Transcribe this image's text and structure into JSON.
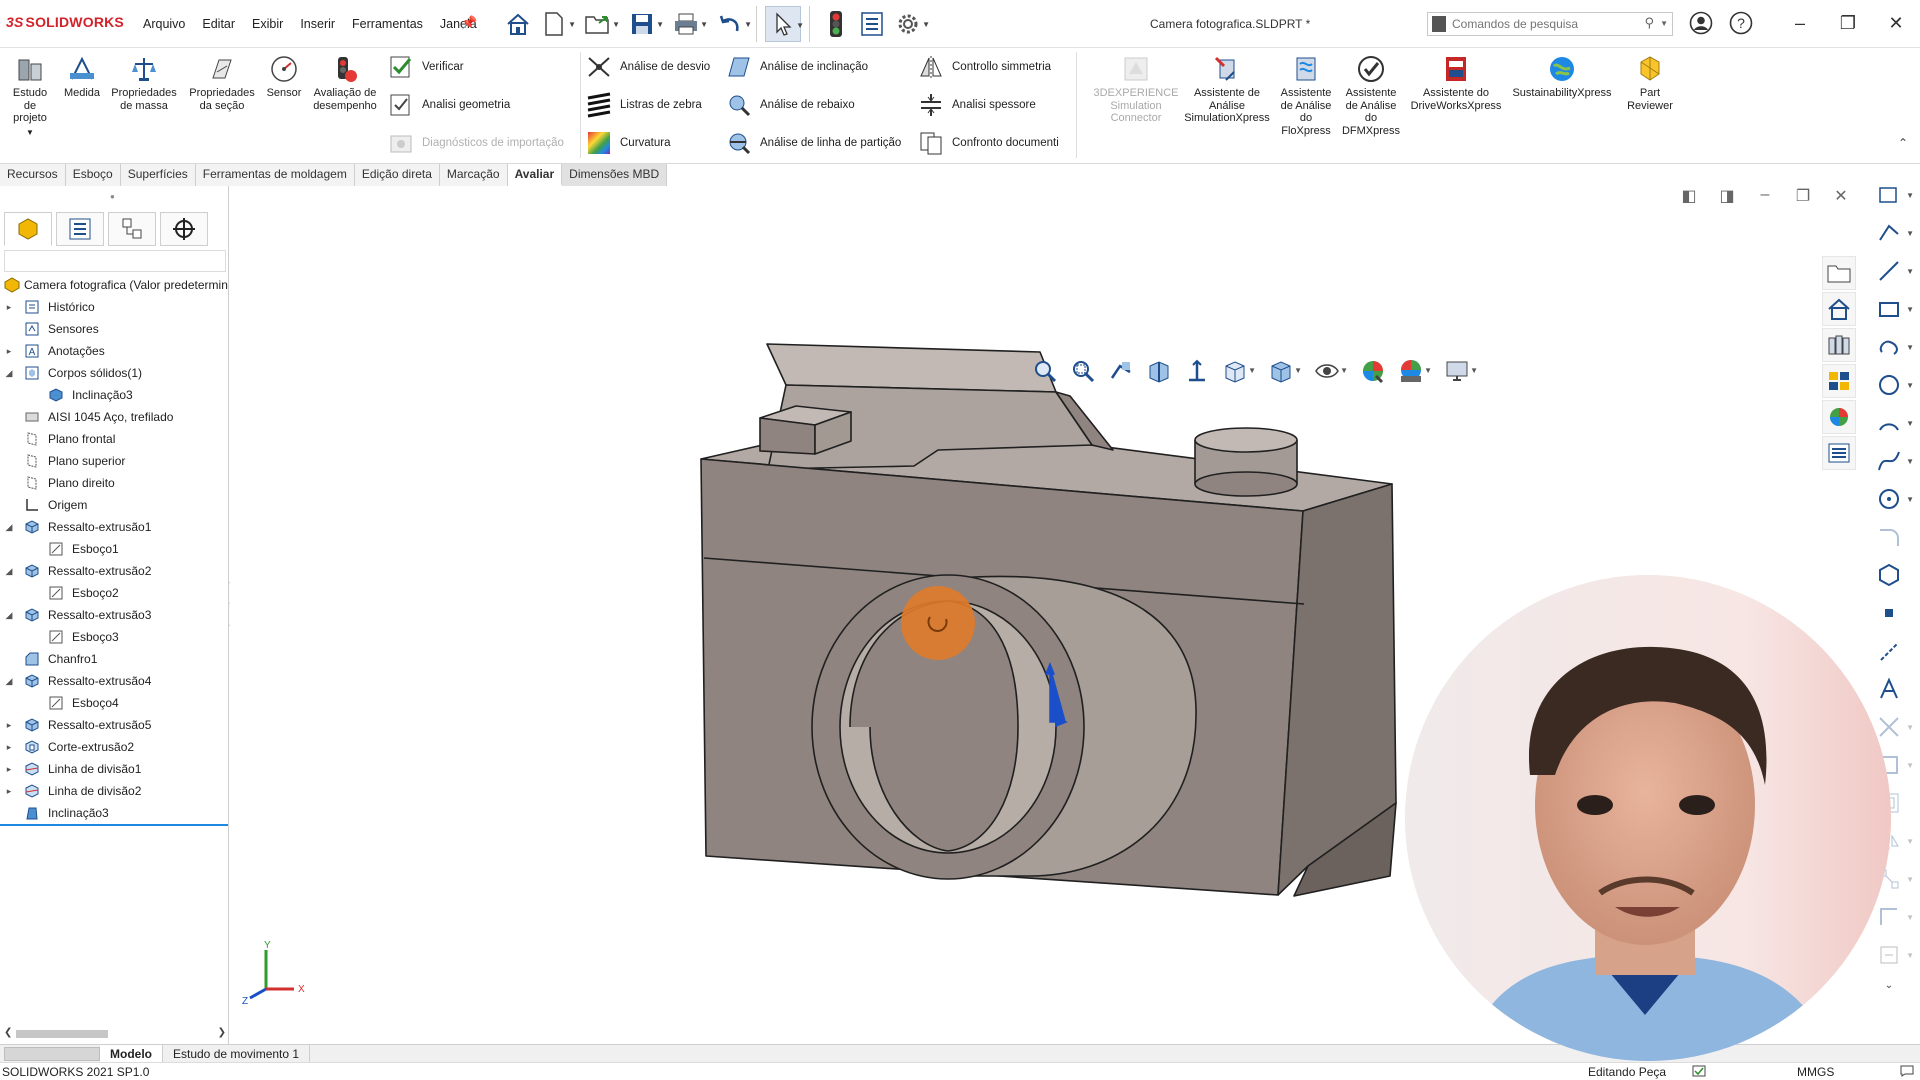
{
  "app": {
    "logo": "SOLIDWORKS",
    "document_title": "Camera fotografica.SLDPRT *",
    "menu": [
      "Arquivo",
      "Editar",
      "Exibir",
      "Inserir",
      "Ferramentas",
      "Janela"
    ],
    "search_placeholder": "Comandos de pesquisa"
  },
  "ribbon": {
    "large_buttons": [
      {
        "label": "Estudo de projeto",
        "icon": "design-study-icon"
      },
      {
        "label": "Medida",
        "icon": "measure-icon"
      },
      {
        "label": "Propriedades de massa",
        "icon": "mass-properties-icon"
      },
      {
        "label": "Propriedades da seção",
        "icon": "section-properties-icon"
      },
      {
        "label": "Sensor",
        "icon": "sensor-icon"
      },
      {
        "label": "Avaliação de desempenho",
        "icon": "performance-evaluation-icon"
      }
    ],
    "check_group": [
      {
        "label": "Verificar",
        "icon": "check-icon"
      },
      {
        "label": "Analisi geometria",
        "icon": "geometry-analysis-icon"
      },
      {
        "label": "Diagnósticos de importação",
        "icon": "import-diagnostics-icon",
        "disabled": true
      }
    ],
    "analysis_col1": [
      {
        "label": "Análise de desvio",
        "icon": "deviation-analysis-icon"
      },
      {
        "label": "Listras de zebra",
        "icon": "zebra-stripes-icon"
      },
      {
        "label": "Curvatura",
        "icon": "curvature-icon"
      }
    ],
    "analysis_col2": [
      {
        "label": "Análise de inclinação",
        "icon": "draft-analysis-icon"
      },
      {
        "label": "Análise de rebaixo",
        "icon": "undercut-analysis-icon"
      },
      {
        "label": "Análise de linha de partição",
        "icon": "parting-line-analysis-icon"
      }
    ],
    "analysis_col3": [
      {
        "label": "Controllo simmetria",
        "icon": "symmetry-check-icon"
      },
      {
        "label": "Analisi spessore",
        "icon": "thickness-analysis-icon"
      },
      {
        "label": "Confronto documenti",
        "icon": "compare-documents-icon"
      }
    ],
    "addins": [
      {
        "label": "3DEXPERIENCE Simulation Connector",
        "icon": "3dexperience-icon",
        "disabled": true
      },
      {
        "label": "Assistente de Análise SimulationXpress",
        "icon": "simulationxpress-icon"
      },
      {
        "label": "Assistente de Análise do FloXpress",
        "icon": "floxpress-icon"
      },
      {
        "label": "Assistente de Análise do DFMXpress",
        "icon": "dfmxpress-icon"
      },
      {
        "label": "Assistente do DriveWorksXpress",
        "icon": "driveworksxpress-icon"
      },
      {
        "label": "SustainabilityXpress",
        "icon": "sustainabilityxpress-icon"
      },
      {
        "label": "Part Reviewer",
        "icon": "part-reviewer-icon"
      }
    ]
  },
  "tabs": [
    "Recursos",
    "Esboço",
    "Superfícies",
    "Ferramentas de moldagem",
    "Edição direta",
    "Marcação",
    "Avaliar",
    "Dimensões MBD"
  ],
  "active_tab": "Avaliar",
  "feature_tree": {
    "root": "Camera fotografica  (Valor predetermin",
    "items": [
      {
        "label": "Histórico",
        "icon": "history-icon",
        "level": 1,
        "expand": "collapsed"
      },
      {
        "label": "Sensores",
        "icon": "sensors-icon",
        "level": 1,
        "expand": "none"
      },
      {
        "label": "Anotações",
        "icon": "annotations-icon",
        "level": 1,
        "expand": "collapsed"
      },
      {
        "label": "Corpos sólidos(1)",
        "icon": "solid-bodies-icon",
        "level": 1,
        "expand": "expanded"
      },
      {
        "label": "Inclinação3",
        "icon": "body-icon",
        "level": 2,
        "expand": "none"
      },
      {
        "label": "AISI 1045 Aço, trefilado",
        "icon": "material-icon",
        "level": 1,
        "expand": "none"
      },
      {
        "label": "Plano frontal",
        "icon": "plane-icon",
        "level": 1,
        "expand": "none"
      },
      {
        "label": "Plano superior",
        "icon": "plane-icon",
        "level": 1,
        "expand": "none"
      },
      {
        "label": "Plano direito",
        "icon": "plane-icon",
        "level": 1,
        "expand": "none"
      },
      {
        "label": "Origem",
        "icon": "origin-icon",
        "level": 1,
        "expand": "none"
      },
      {
        "label": "Ressalto-extrusão1",
        "icon": "extrude-icon",
        "level": 1,
        "expand": "expanded"
      },
      {
        "label": "Esboço1",
        "icon": "sketch-icon",
        "level": 2,
        "expand": "none"
      },
      {
        "label": "Ressalto-extrusão2",
        "icon": "extrude-icon",
        "level": 1,
        "expand": "expanded"
      },
      {
        "label": "Esboço2",
        "icon": "sketch-icon",
        "level": 2,
        "expand": "none"
      },
      {
        "label": "Ressalto-extrusão3",
        "icon": "extrude-icon",
        "level": 1,
        "expand": "expanded"
      },
      {
        "label": "Esboço3",
        "icon": "sketch-icon",
        "level": 2,
        "expand": "none"
      },
      {
        "label": "Chanfro1",
        "icon": "chamfer-icon",
        "level": 1,
        "expand": "none"
      },
      {
        "label": "Ressalto-extrusão4",
        "icon": "extrude-icon",
        "level": 1,
        "expand": "expanded"
      },
      {
        "label": "Esboço4",
        "icon": "sketch-icon",
        "level": 2,
        "expand": "none"
      },
      {
        "label": "Ressalto-extrusão5",
        "icon": "extrude-icon",
        "level": 1,
        "expand": "collapsed"
      },
      {
        "label": "Corte-extrusão2",
        "icon": "cut-extrude-icon",
        "level": 1,
        "expand": "collapsed"
      },
      {
        "label": "Linha de divisão1",
        "icon": "split-line-icon",
        "level": 1,
        "expand": "collapsed"
      },
      {
        "label": "Linha de divisão2",
        "icon": "split-line-icon",
        "level": 1,
        "expand": "collapsed"
      },
      {
        "label": "Inclinação3",
        "icon": "draft-icon",
        "level": 1,
        "expand": "none"
      }
    ]
  },
  "bottom_tabs": [
    "Modelo",
    "Estudo de movimento 1"
  ],
  "active_bottom_tab": "Modelo",
  "status": {
    "version": "SOLIDWORKS 2021 SP1.0",
    "editing": "Editando Peça",
    "units": "MMGS"
  },
  "triad": {
    "x": "X",
    "y": "Y",
    "z": "Z"
  },
  "colors": {
    "accent": "#1e88e5",
    "brand": "#d2232a",
    "model_face": "#8f8480",
    "model_top": "#b2a9a4",
    "model_edge": "#202020",
    "cursor_marker": "#e07b2a"
  }
}
